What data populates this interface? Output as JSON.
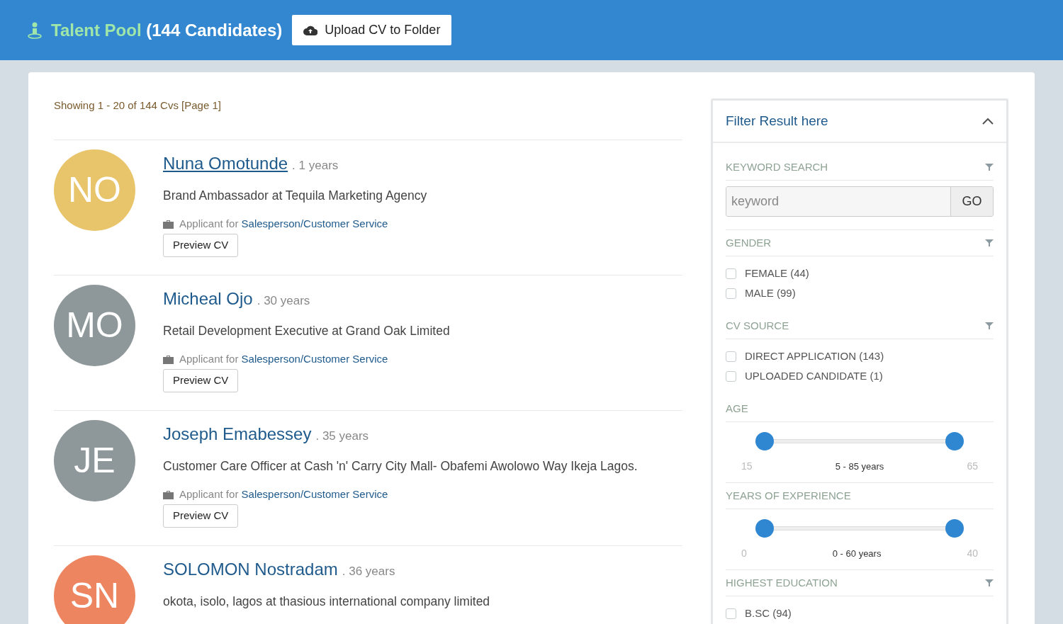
{
  "header": {
    "title": "Talent Pool",
    "count": "(144 Candidates)",
    "upload_button": "Upload CV to Folder"
  },
  "results": {
    "summary": "Showing 1 - 20 of 144 Cvs [Page 1]",
    "candidates": [
      {
        "initials": "NO",
        "color": "#e8c46a",
        "name": "Nuna Omotunde",
        "underlined": true,
        "experience": ". 1 years",
        "headline": "Brand Ambassador at Tequila Marketing Agency",
        "applicant_label": "Applicant for",
        "job": "Salesperson/Customer Service",
        "button": "Preview CV"
      },
      {
        "initials": "MO",
        "color": "#8e9799",
        "name": "Micheal Ojo",
        "underlined": false,
        "experience": ". 30 years",
        "headline": "Retail Development Executive at Grand Oak Limited",
        "applicant_label": "Applicant for",
        "job": "Salesperson/Customer Service",
        "button": "Preview CV"
      },
      {
        "initials": "JE",
        "color": "#8e9799",
        "name": "Joseph Emabessey",
        "underlined": false,
        "experience": ". 35 years",
        "headline": "Customer Care Officer at Cash 'n' Carry City Mall- Obafemi Awolowo Way Ikeja Lagos.",
        "applicant_label": "Applicant for",
        "job": "Salesperson/Customer Service",
        "button": "Preview CV"
      },
      {
        "initials": "SN",
        "color": "#ee8561",
        "name": "SOLOMON Nostradam",
        "underlined": false,
        "experience": ". 36 years",
        "headline": "okota, isolo, lagos at thasious international company limited"
      }
    ]
  },
  "filter": {
    "title": "Filter Result here",
    "expanded": true,
    "sections": [
      {
        "kind": "search",
        "title": "KEYWORD SEARCH",
        "placeholder": "keyword",
        "button": "GO"
      },
      {
        "kind": "checks",
        "title": "GENDER",
        "options": [
          {
            "label": "FEMALE (44)",
            "checked": false
          },
          {
            "label": "MALE (99)",
            "checked": false
          }
        ]
      },
      {
        "kind": "checks",
        "title": "CV SOURCE",
        "options": [
          {
            "label": "DIRECT APPLICATION (143)",
            "checked": false
          },
          {
            "label": "UPLOADED CANDIDATE (1)",
            "checked": false
          }
        ]
      },
      {
        "kind": "range",
        "title": "AGE",
        "thumbs": [
          {
            "level": 0.04
          },
          {
            "level": 0.96
          }
        ],
        "min": "15",
        "reading": "5 - 85 years",
        "max": "65"
      },
      {
        "kind": "range",
        "title": "YEARS OF EXPERIENCE",
        "thumbs": [
          {
            "level": 0.04
          },
          {
            "level": 0.96
          }
        ],
        "min": "0",
        "reading": "0 - 60 years",
        "max": "40"
      },
      {
        "kind": "checks",
        "title": "HIGHEST EDUCATION",
        "options": [
          {
            "label": "B.SC (94)",
            "checked": false
          }
        ]
      }
    ]
  }
}
